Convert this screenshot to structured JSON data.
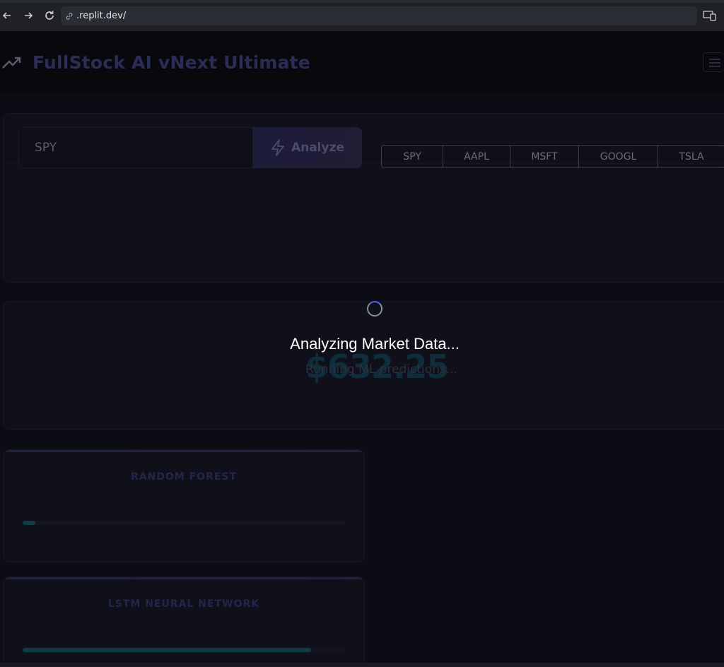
{
  "browser": {
    "url": ".replit.dev/",
    "back_icon": "arrow-left-icon",
    "forward_icon": "arrow-right-icon",
    "reload_icon": "reload-icon",
    "site_icon": "link-icon",
    "device_icon": "device-mode-icon"
  },
  "app": {
    "title": "FullStock AI vNext Ultimate",
    "logo_icon": "trending-up-icon",
    "menu_icon": "menu-icon"
  },
  "search": {
    "value": "SPY",
    "analyze_label": "Analyze",
    "analyze_icon": "bolt-icon"
  },
  "quick_tickers": [
    "SPY",
    "AAPL",
    "MSFT",
    "GOOGL",
    "TSLA"
  ],
  "price": {
    "value": "$632.25",
    "subtext": "Running ML predictions..."
  },
  "loading": {
    "text": "Analyzing Market Data..."
  },
  "models": [
    {
      "name": "RANDOM FOREST",
      "progress": 0.04
    },
    {
      "name": "LSTM NEURAL NETWORK",
      "progress": 0.89
    }
  ],
  "colors": {
    "accent": "#4f63ff",
    "background": "#0c0c14"
  }
}
